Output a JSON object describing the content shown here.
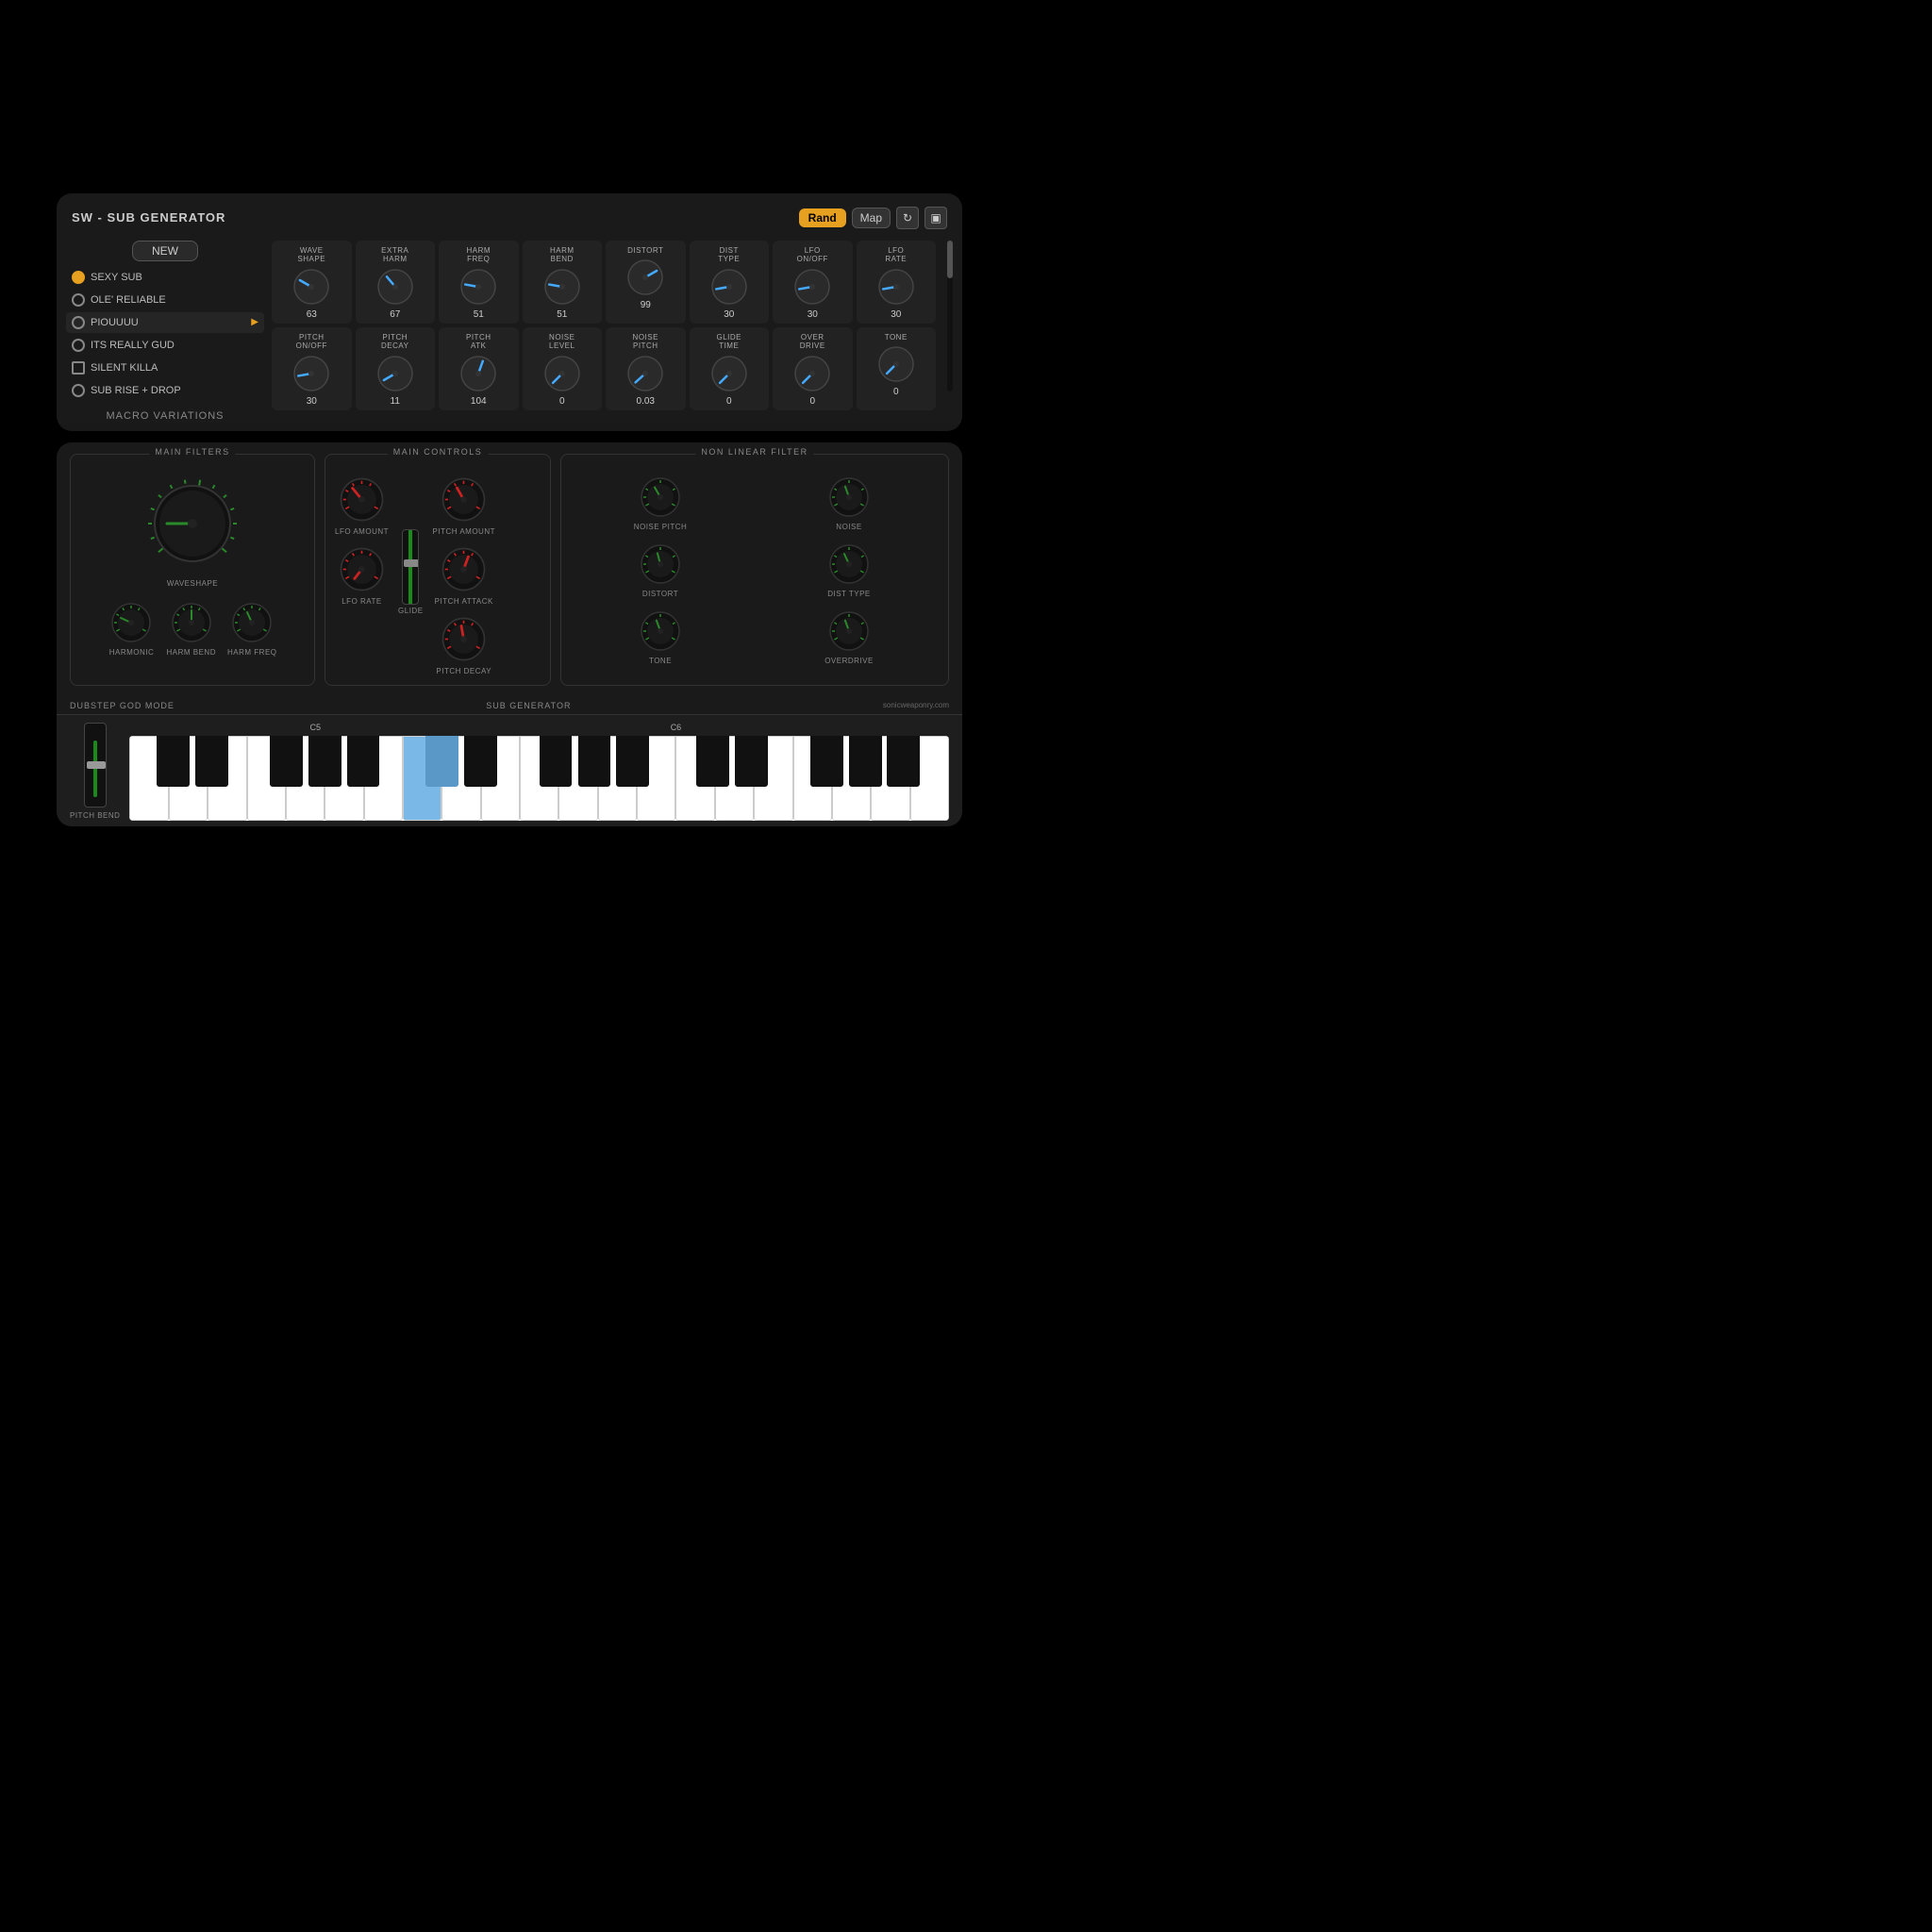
{
  "top_panel": {
    "title": "SW - SUB GENERATOR",
    "buttons": {
      "rand": "Rand",
      "map": "Map",
      "new": "NEW"
    },
    "presets": [
      {
        "name": "SEXY SUB",
        "icon": "orange"
      },
      {
        "name": "OLE' RELIABLE",
        "icon": "gray"
      },
      {
        "name": "PIOUUUU",
        "icon": "gray",
        "active": true,
        "has_arrow": true
      },
      {
        "name": "ITS REALLY GUD",
        "icon": "gray"
      },
      {
        "name": "SILENT KILLA",
        "icon": "list"
      },
      {
        "name": "SUB RISE + DROP",
        "icon": "gray"
      }
    ],
    "macro_label": "MACRO VARIATIONS",
    "knob_rows": [
      [
        {
          "label": "WAVE\nSHAPE",
          "value": "63",
          "angle": -60
        },
        {
          "label": "EXTRA\nHARM",
          "value": "67",
          "angle": -40
        },
        {
          "label": "HARM\nFREQ",
          "value": "51",
          "angle": -80
        },
        {
          "label": "HARM\nBEND",
          "value": "51",
          "angle": -80
        },
        {
          "label": "DISTORT",
          "value": "99",
          "angle": 60
        },
        {
          "label": "DIST\nTYPE",
          "value": "30",
          "angle": -100
        },
        {
          "label": "LFO\nON/OFF",
          "value": "30",
          "angle": -100
        },
        {
          "label": "LFO\nRATE",
          "value": "30",
          "angle": -100
        }
      ],
      [
        {
          "label": "PITCH\nON/OFF",
          "value": "30",
          "angle": -100
        },
        {
          "label": "PITCH\nDECAY",
          "value": "11",
          "angle": -120
        },
        {
          "label": "PITCH\nATK",
          "value": "104",
          "angle": 20
        },
        {
          "label": "NOISE\nLEVEL",
          "value": "0",
          "angle": -135
        },
        {
          "label": "NOISE\nPITCH",
          "value": "0.03",
          "angle": -130
        },
        {
          "label": "GLIDE\nTIME",
          "value": "0",
          "angle": -135
        },
        {
          "label": "OVER\nDRIVE",
          "value": "0",
          "angle": -135
        },
        {
          "label": "TONE",
          "value": "0",
          "angle": -135
        }
      ]
    ]
  },
  "bottom_panel": {
    "sections": {
      "main_filters": "MAIN FILTERS",
      "main_controls": "MAIN CONTROLS",
      "non_linear": "NON LINEAR FILTER"
    },
    "labels": {
      "waveshape": "WAVESHAPE",
      "harmonic": "HARMONIC",
      "harm_bend": "HARM BEND",
      "harm_freq": "HARM FREQ",
      "lfo_amount": "LFO AMOUNT",
      "lfo_rate": "LFO RATE",
      "glide": "GLIDE",
      "pitch_amount": "PITCH AMOUNT",
      "pitch_attack": "PITCH ATTACK",
      "pitch_decay": "PITCH DECAY",
      "noise_pitch": "NOISE PITCH",
      "noise": "NOISE",
      "distort": "DISTORT",
      "dist_type": "DIST TYPE",
      "tone": "TONE",
      "overdrive": "OVERDRIVE"
    },
    "bottom_bar": {
      "left": "DUBSTEP GOD MODE",
      "center": "SUB GENERATOR",
      "right": "sonicweaponry.com"
    },
    "piano": {
      "pitch_bend": "PITCH BEND",
      "c5_label": "C5",
      "c6_label": "C6"
    }
  }
}
